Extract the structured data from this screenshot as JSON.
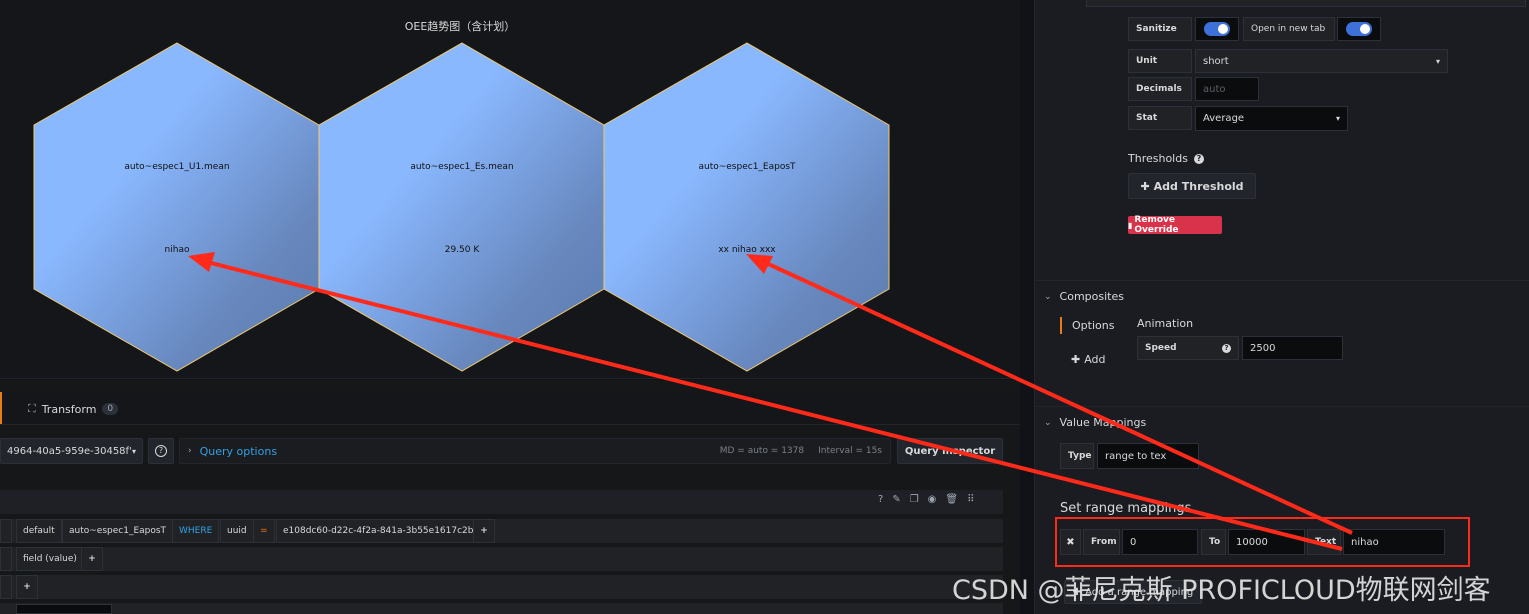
{
  "panel": {
    "title": "OEE趋势图（含计划）",
    "hexagons": [
      {
        "name": "auto~espec1_U1.mean",
        "value": "nihao"
      },
      {
        "name": "auto~espec1_Es.mean",
        "value": "29.50 K"
      },
      {
        "name": "auto~espec1_EaposT",
        "value": "xx nihao xxx"
      }
    ],
    "colors": {
      "hex_light": "#8ab8ff",
      "hex_dark": "#5b7cb0",
      "hex_stroke": "#f2c96d"
    }
  },
  "tabs": {
    "transform_label": "Transform",
    "transform_count": "0"
  },
  "query_bar": {
    "datasource_value": "4964-40a5-959e-30458f'",
    "query_options_label": "Query options",
    "md_text": "MD = auto = 1378",
    "interval_text": "Interval = 15s",
    "query_inspector_label": "Query inspector"
  },
  "query_row": {
    "from_policy": "default",
    "measurement": "auto~espec1_EaposT",
    "where_kw": "WHERE",
    "tag_key": "uuid",
    "operator": "=",
    "tag_value": "e108dc60-d22c-4f2a-841a-3b55e1617c2b",
    "select_field": "field (value)",
    "plus": "+"
  },
  "options": {
    "sanitize_label": "Sanitize",
    "open_new_tab_label": "Open in new tab",
    "unit_label": "Unit",
    "unit_value": "short",
    "decimals_label": "Decimals",
    "decimals_placeholder": "auto",
    "stat_label": "Stat",
    "stat_value": "Average",
    "thresholds_label": "Thresholds",
    "add_threshold_label": "Add Threshold",
    "remove_override_label": "Remove Override"
  },
  "composites": {
    "title": "Composites",
    "options_tab": "Options",
    "add_label": "Add",
    "animation_label": "Animation",
    "speed_label": "Speed",
    "speed_value": "2500"
  },
  "value_mappings": {
    "title": "Value Mappings",
    "type_label": "Type",
    "type_value": "range to tex",
    "set_range_title": "Set range mappings",
    "from_label": "From",
    "from_value": "0",
    "to_label": "To",
    "to_value": "10000",
    "text_label": "Text",
    "text_value": "nihao",
    "add_range_label": "Add a range mapping"
  },
  "watermark": "CSDN @菲尼克斯 PROFICLOUD物联网剑客"
}
